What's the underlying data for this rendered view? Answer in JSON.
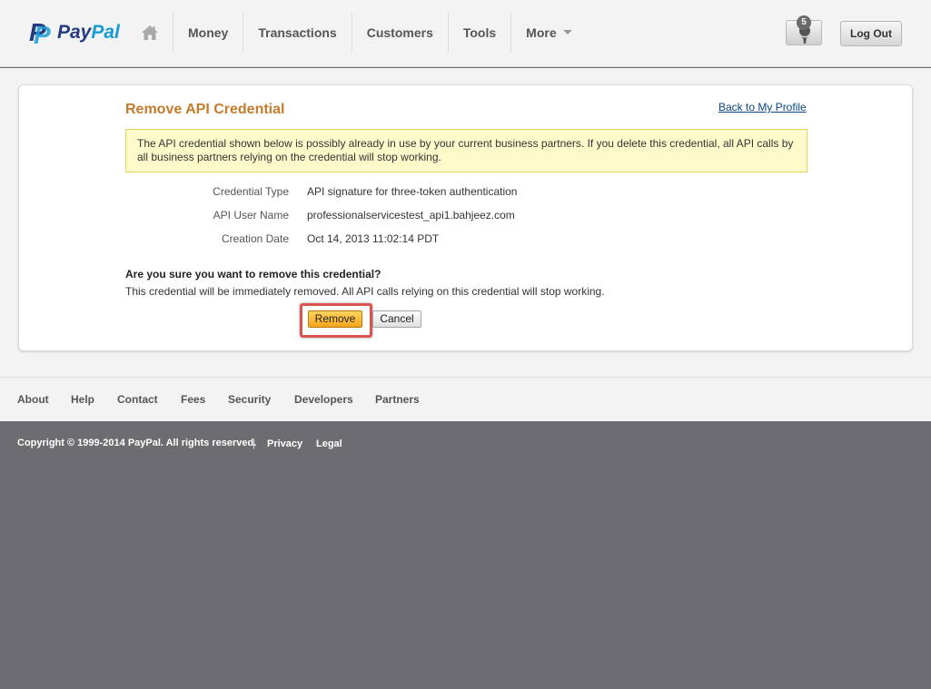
{
  "header": {
    "logo": {
      "pay": "Pay",
      "pal": "Pal"
    },
    "nav": [
      {
        "label": "Money"
      },
      {
        "label": "Transactions"
      },
      {
        "label": "Customers"
      },
      {
        "label": "Tools"
      },
      {
        "label": "More"
      }
    ],
    "notification_count": "5",
    "logout_label": "Log Out"
  },
  "main": {
    "title": "Remove API Credential",
    "back_link": "Back to My Profile",
    "warning": "The API credential shown below is possibly already in use by your current business partners. If you delete this credential, all API calls by all business partners relying on the credential will stop working.",
    "details": [
      {
        "label": "Credential Type",
        "value": "API signature for three-token authentication"
      },
      {
        "label": "API User Name",
        "value": "professionalservicestest_api1.bahjeez.com"
      },
      {
        "label": "Creation Date",
        "value": "Oct 14, 2013 11:02:14 PDT"
      }
    ],
    "confirm_question": "Are you sure you want to remove this credential?",
    "confirm_description": "This credential will be immediately removed. All API calls relying on this credential will stop working.",
    "remove_label": "Remove",
    "cancel_label": "Cancel"
  },
  "footer": {
    "links": [
      "About",
      "Help",
      "Contact",
      "Fees",
      "Security",
      "Developers",
      "Partners"
    ],
    "copyright": "Copyright © 1999-2014 PayPal. All rights reserved.",
    "separator": "|",
    "privacy": "Privacy",
    "legal": "Legal"
  },
  "colors": {
    "title_orange": "#c47b2c",
    "link_blue": "#084482",
    "warning_bg": "#fefbcb",
    "highlight_red": "#d9534f",
    "footer_dark": "#6d6c71"
  },
  "icons": [
    "paypal-logo",
    "home-icon",
    "caret-down-icon",
    "profile-icon"
  ]
}
